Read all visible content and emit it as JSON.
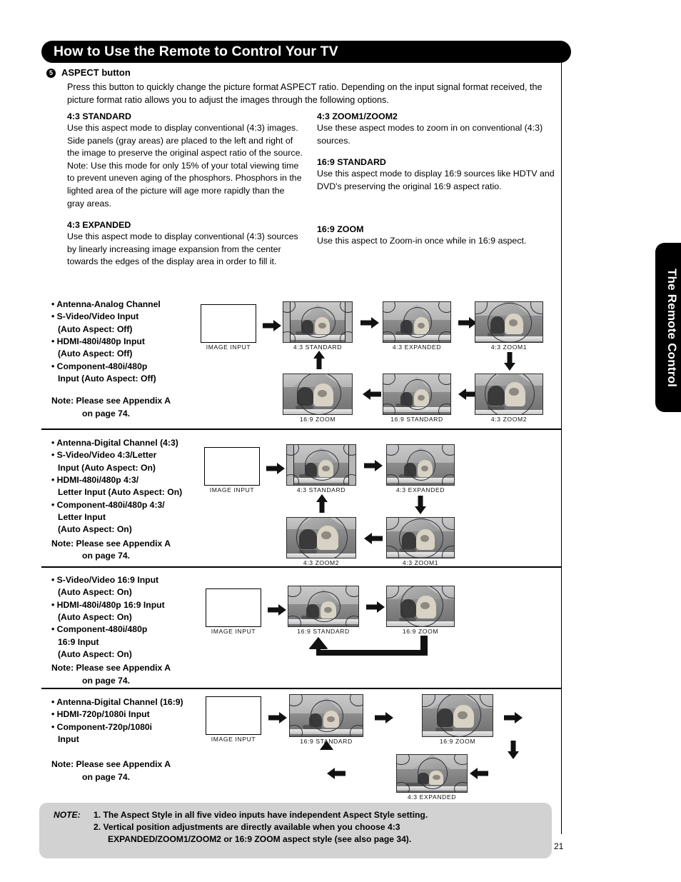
{
  "header": {
    "title": "How to Use the Remote to Control Your TV"
  },
  "intro": {
    "number": "5",
    "title": "ASPECT button",
    "body": "Press this button to quickly change the picture format ASPECT ratio. Depending on the input signal format received, the picture format ratio allows you to adjust the images through the following options."
  },
  "definitions": {
    "left": [
      {
        "heading": "4:3 STANDARD",
        "text": "Use this aspect mode to display conventional (4:3) images. Side panels (gray areas) are placed to the left and right of the image to preserve the original aspect ratio of the source.  Note: Use this mode for only 15% of your total viewing time to prevent uneven aging of the phosphors.  Phosphors in the lighted area of the picture will age more rapidly than the gray areas."
      },
      {
        "heading": "4:3 EXPANDED",
        "text": "Use this aspect mode to display conventional (4:3) sources by linearly increasing image expansion from the center towards the edges of the display area in order to fill it."
      }
    ],
    "right": [
      {
        "heading": "4:3 ZOOM1/ZOOM2",
        "text": "Use these aspect modes to zoom in on conventional (4:3) sources."
      },
      {
        "heading": "16:9 STANDARD",
        "text": "Use this aspect mode to display 16:9 sources like HDTV and DVD's preserving the original 16:9 aspect ratio."
      },
      {
        "heading": "16:9 ZOOM",
        "text": "Use this aspect to Zoom-in once while in 16:9 aspect."
      }
    ]
  },
  "sections": [
    {
      "bullets": [
        {
          "text": "• Antenna-Analog Channel",
          "indent": false
        },
        {
          "text": "• S-Video/Video Input",
          "indent": false
        },
        {
          "text": "(Auto Aspect: Off)",
          "indent": true
        },
        {
          "text": "• HDMI-480i/480p Input",
          "indent": false
        },
        {
          "text": " (Auto Aspect: Off)",
          "indent": true
        },
        {
          "text": "• Component-480i/480p",
          "indent": false
        },
        {
          "text": "Input (Auto Aspect: Off)",
          "indent": true
        }
      ],
      "note_line1": "Note:  Please see Appendix A",
      "note_line2": "on page 74.",
      "input_caption": "IMAGE INPUT",
      "captions": {
        "r1a": "4:3 STANDARD",
        "r1b": "4:3 EXPANDED",
        "r1c": "4:3 ZOOM1",
        "r2a": "16:9 ZOOM",
        "r2b": "16:9 STANDARD",
        "r2c": "4:3 ZOOM2"
      }
    },
    {
      "bullets": [
        {
          "text": "• Antenna-Digital Channel (4:3)",
          "indent": false
        },
        {
          "text": "• S-Video/Video 4:3/Letter",
          "indent": false
        },
        {
          "text": "Input (Auto Aspect: On)",
          "indent": true
        },
        {
          "text": "• HDMI-480i/480p 4:3/",
          "indent": false
        },
        {
          "text": "Letter Input (Auto Aspect: On)",
          "indent": true
        },
        {
          "text": "• Component-480i/480p 4:3/",
          "indent": false
        },
        {
          "text": "Letter Input",
          "indent": true
        },
        {
          "text": "(Auto Aspect: On)",
          "indent": true
        }
      ],
      "note_line1": "Note:  Please see Appendix A",
      "note_line2": "on page 74.",
      "input_caption": "IMAGE INPUT",
      "captions": {
        "r1a": "4:3 STANDARD",
        "r1b": "4:3 EXPANDED",
        "r2a": "4:3 ZOOM2",
        "r2b": "4:3 ZOOM1"
      }
    },
    {
      "bullets": [
        {
          "text": "• S-Video/Video 16:9 Input",
          "indent": false
        },
        {
          "text": "(Auto Aspect: On)",
          "indent": true
        },
        {
          "text": "• HDMI-480i/480p 16:9 Input",
          "indent": false
        },
        {
          "text": "(Auto Aspect: On)",
          "indent": true
        },
        {
          "text": "• Component-480i/480p",
          "indent": false
        },
        {
          "text": "16:9 Input",
          "indent": true
        },
        {
          "text": "(Auto Aspect: On)",
          "indent": true
        }
      ],
      "note_line1": "Note:  Please see Appendix A",
      "note_line2": "on page 74.",
      "input_caption": "IMAGE INPUT",
      "captions": {
        "r1a": "16:9 STANDARD",
        "r1b": "16:9 ZOOM"
      }
    },
    {
      "bullets": [
        {
          "text": "• Antenna-Digital Channel (16:9)",
          "indent": false
        },
        {
          "text": "• HDMI-720p/1080i Input",
          "indent": false
        },
        {
          "text": "• Component-720p/1080i",
          "indent": false
        },
        {
          "text": "Input",
          "indent": true
        }
      ],
      "note_line1": "Note:  Please see Appendix A",
      "note_line2": "on page 74.",
      "input_caption": "IMAGE INPUT",
      "captions": {
        "r1a": "16:9 STANDARD",
        "r1b": "16:9 ZOOM",
        "r2a": "4:3 EXPANDED"
      }
    }
  ],
  "note_box": {
    "label": "NOTE:",
    "item1": "1. The Aspect Style in all five video inputs have independent Aspect Style setting.",
    "item2": "2.  Vertical position adjustments are directly available when you choose 4:3",
    "item3": "EXPANDED/ZOOM1/ZOOM2 or 16:9 ZOOM aspect style (see also page 34)."
  },
  "page_number": "21",
  "side_tab": {
    "label": "The Remote Control"
  }
}
